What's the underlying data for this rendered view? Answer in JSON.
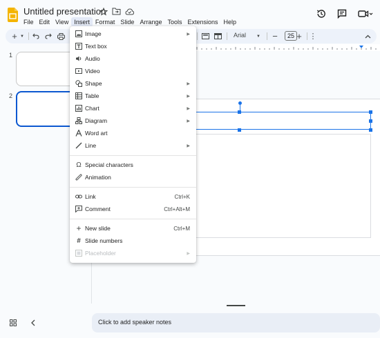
{
  "app": {
    "title": "Untitled presentation",
    "accent": "#0b57d0",
    "logo_color": "#f4b400"
  },
  "menubar": [
    "File",
    "Edit",
    "View",
    "Insert",
    "Format",
    "Slide",
    "Arrange",
    "Tools",
    "Extensions",
    "Help"
  ],
  "toolbar": {
    "font": "Arial",
    "font_size": "25"
  },
  "filmstrip": {
    "slides": [
      {
        "number": "1"
      },
      {
        "number": "2"
      }
    ]
  },
  "notes": {
    "placeholder": "Click to add speaker notes"
  },
  "insert_menu": {
    "items": [
      {
        "label": "Image",
        "icon": "image-icon",
        "submenu": true
      },
      {
        "label": "Text box",
        "icon": "text-box-icon"
      },
      {
        "label": "Audio",
        "icon": "audio-icon"
      },
      {
        "label": "Video",
        "icon": "video-icon"
      },
      {
        "label": "Shape",
        "icon": "shape-icon",
        "submenu": true
      },
      {
        "label": "Table",
        "icon": "table-icon",
        "submenu": true
      },
      {
        "label": "Chart",
        "icon": "chart-icon",
        "submenu": true
      },
      {
        "label": "Diagram",
        "icon": "diagram-icon",
        "submenu": true
      },
      {
        "label": "Word art",
        "icon": "word-art-icon"
      },
      {
        "label": "Line",
        "icon": "line-icon",
        "submenu": true
      },
      {
        "label": "Special characters",
        "icon": "omega-icon"
      },
      {
        "label": "Animation",
        "icon": "animation-icon"
      },
      {
        "label": "Link",
        "icon": "link-icon",
        "shortcut": "Ctrl+K"
      },
      {
        "label": "Comment",
        "icon": "comment-icon",
        "shortcut": "Ctrl+Alt+M"
      },
      {
        "label": "New slide",
        "icon": "plus-icon",
        "shortcut": "Ctrl+M"
      },
      {
        "label": "Slide numbers",
        "icon": "hash-icon"
      },
      {
        "label": "Placeholder",
        "icon": "placeholder-icon",
        "submenu": true,
        "disabled": true
      }
    ]
  }
}
